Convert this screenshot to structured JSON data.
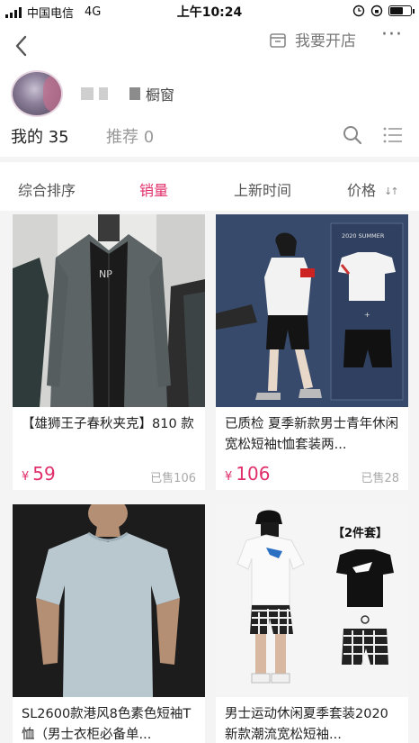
{
  "status_bar": {
    "carrier": "中国电信",
    "network": "4G",
    "time": "上午10:24"
  },
  "nav": {
    "open_shop_label": "我要开店",
    "more_label": "···"
  },
  "profile": {
    "shop_name_visible": "橱窗"
  },
  "tabs": {
    "mine": "我的 35",
    "recommend": "推荐 0"
  },
  "sort_bar": {
    "composite": "综合排序",
    "sales": "销量",
    "new_arrivals": "上新时间",
    "price": "价格"
  },
  "products": [
    {
      "title": "【雄狮王子春秋夹克】810 款",
      "currency": "¥",
      "price": "59",
      "sold": "已售106"
    },
    {
      "title": "已质检 夏季新款男士青年休闲宽松短袖t恤套装两...",
      "currency": "¥",
      "price": "106",
      "sold": "已售28",
      "image_text_top": "2020 SUMMER"
    },
    {
      "title": "SL2600款港风8色素色短袖T恤（男士衣柜必备单...",
      "currency": "¥",
      "price": "",
      "sold": ""
    },
    {
      "title": "男士运动休闲夏季套装2020新款潮流宽松短袖...",
      "currency": "¥",
      "price": "",
      "sold": "",
      "image_text_top": "【2件套】"
    }
  ],
  "colors": {
    "accent": "#e02e6a",
    "muted": "#999999",
    "background_grid": "#f4f4f4"
  }
}
